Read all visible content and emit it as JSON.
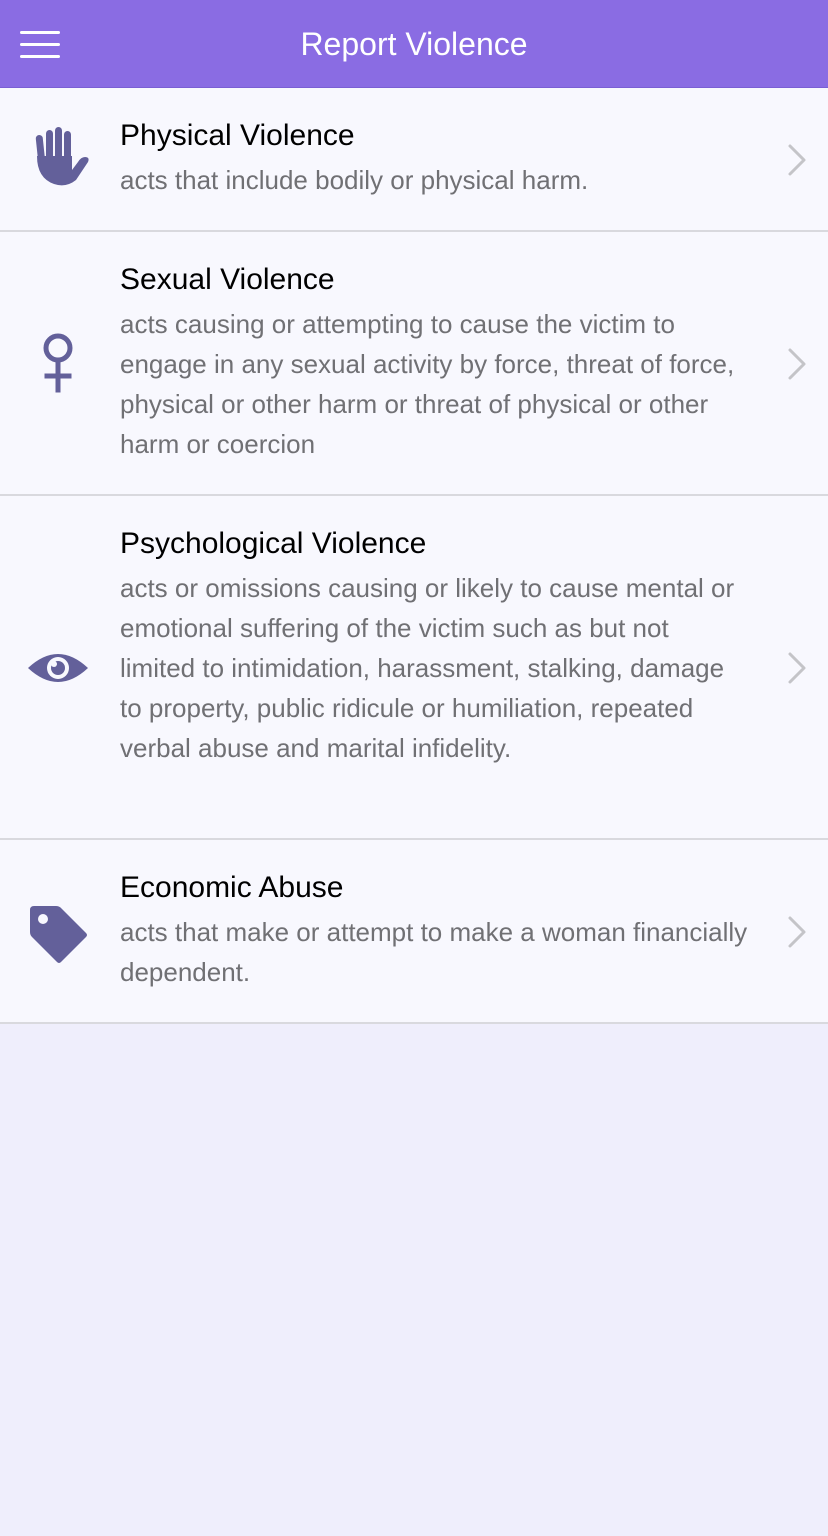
{
  "header": {
    "title": "Report Violence",
    "menu_icon": "hamburger-menu-icon"
  },
  "colors": {
    "header_bg": "#8a6ce3",
    "icon": "#63609a",
    "chevron": "#c4c4c8",
    "page_bg": "#efeefc"
  },
  "items": [
    {
      "title": "Physical Violence",
      "description": "acts that include bodily or physical harm.",
      "icon": "hand-icon"
    },
    {
      "title": "Sexual Violence",
      "description": "acts causing or attempting to cause the victim to engage in any sexual activity by force, threat of force, physical or other harm or threat of physical or other harm or coercion",
      "icon": "female-symbol-icon"
    },
    {
      "title": "Psychological Violence",
      "description": "acts or omissions causing or likely to cause mental or emotional suffering of the victim such as but not limited to intimidation, harassment, stalking, damage to property, public ridicule or humiliation, repeated verbal abuse and marital infidelity.",
      "icon": "eye-icon"
    },
    {
      "title": "Economic Abuse",
      "description": "acts that make or attempt to make a woman financially dependent.",
      "icon": "tag-icon"
    }
  ]
}
